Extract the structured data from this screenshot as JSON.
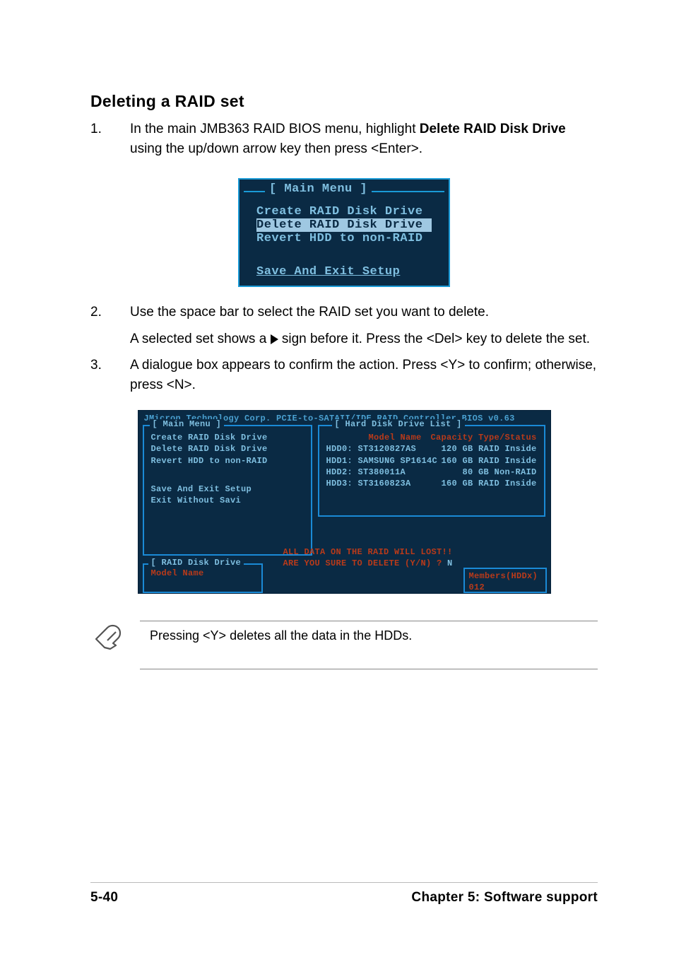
{
  "heading": "Deleting a RAID set",
  "steps": [
    {
      "num": "1.",
      "segments": [
        "In the main JMB363 RAID BIOS menu, highlight ",
        "Delete RAID Disk Drive",
        " using the up/down arrow key then press <Enter>."
      ]
    },
    {
      "num": "2.",
      "text": "Use the space bar to select the RAID set you want to delete.",
      "sub_pre": "A selected set shows a ",
      "sub_post": " sign before it. Press the <Del> key to delete the set."
    },
    {
      "num": "3.",
      "text": "A dialogue box appears to confirm the action. Press <Y> to confirm; otherwise, press <N>."
    }
  ],
  "screenshot1": {
    "title": "[ Main Menu ]",
    "items": [
      "Create RAID Disk Drive",
      "Delete RAID Disk Drive",
      "Revert HDD to non-RAID"
    ],
    "highlighted_index": 1,
    "footer": "Save And Exit Setup"
  },
  "screenshot2": {
    "topline": "JMicron Technology Corp. PCIE-to-SATAII/IDE RAID Controller BIOS v0.63",
    "main_menu": {
      "label": "[ Main Menu ]",
      "items": [
        "Create RAID Disk Drive",
        "Delete RAID Disk Drive",
        "Revert HDD to non-RAID"
      ],
      "extra": [
        "Save And Exit Setup",
        "Exit Without Savi"
      ]
    },
    "hdd_list": {
      "label": "[ Hard Disk Drive List ]",
      "header_cols": [
        "Model Name",
        "Capacity Type/Status"
      ],
      "rows": [
        {
          "name": "HDD0: ST3120827AS",
          "cap": "120 GB RAID Inside"
        },
        {
          "name": "HDD1: SAMSUNG SP1614C",
          "cap": "160 GB RAID Inside"
        },
        {
          "name": "HDD2: ST380011A",
          "cap": "80 GB Non-RAID"
        },
        {
          "name": "HDD3: ST3160823A",
          "cap": "160 GB RAID Inside"
        }
      ]
    },
    "raid_drive": {
      "label": "[ RAID Disk Drive",
      "sub": "Model Name"
    },
    "members_label": "Members(HDDx)",
    "members_sub": "012",
    "prompt_lines": [
      "ALL DATA ON THE RAID WILL LOST!!",
      "ARE YOU SURE TO DELETE (Y/N) ? "
    ],
    "prompt_answer": "N"
  },
  "note_text": "Pressing <Y> deletes all the data in the HDDs.",
  "footer": {
    "left": "5-40",
    "right": "Chapter 5: Software support"
  }
}
